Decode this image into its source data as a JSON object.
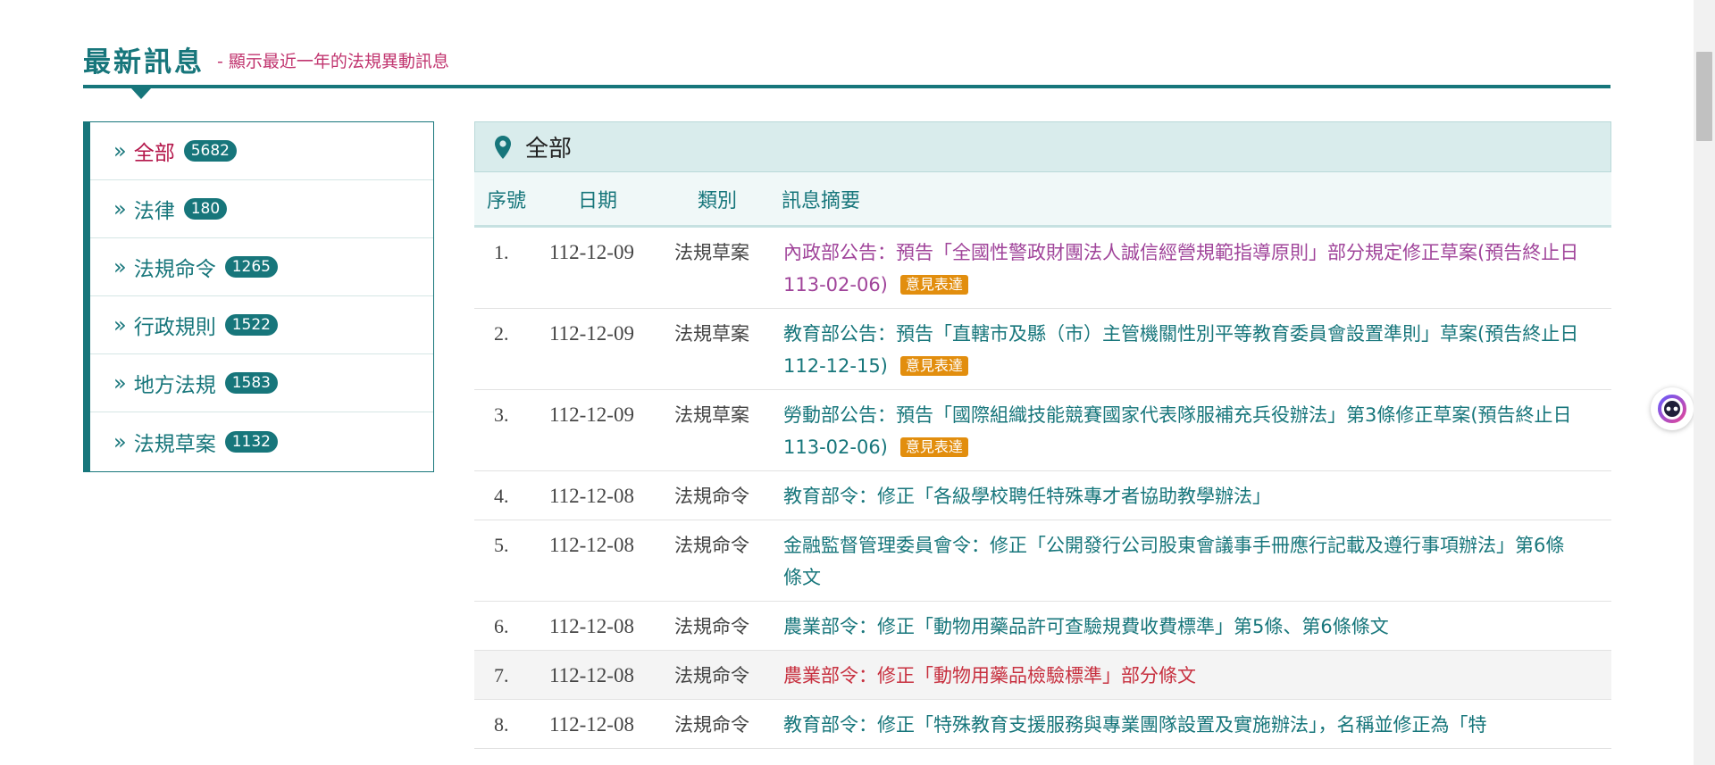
{
  "header": {
    "title": "最新訊息",
    "subtitle": "- 顯示最近一年的法規異動訊息"
  },
  "sidebar": {
    "items": [
      {
        "label": "全部",
        "count": "5682",
        "active": true
      },
      {
        "label": "法律",
        "count": "180"
      },
      {
        "label": "法規命令",
        "count": "1265"
      },
      {
        "label": "行政規則",
        "count": "1522"
      },
      {
        "label": "地方法規",
        "count": "1583"
      },
      {
        "label": "法規草案",
        "count": "1132"
      }
    ]
  },
  "panel": {
    "title": "全部",
    "pin_icon": "map-pin-icon"
  },
  "table": {
    "headers": {
      "no": "序號",
      "date": "日期",
      "category": "類別",
      "summary": "訊息摘要"
    },
    "rows": [
      {
        "no": "1.",
        "date": "112-12-09",
        "category": "法規草案",
        "summary": "內政部公告：預告「全國性警政財團法人誠信經營規範指導原則」部分規定修正草案(預告終止日 113-02-06)",
        "badge": "意見表達"
      },
      {
        "no": "2.",
        "date": "112-12-09",
        "category": "法規草案",
        "summary": "教育部公告：預告「直轄市及縣（市）主管機關性別平等教育委員會設置準則」草案(預告終止日 112-12-15)",
        "badge": "意見表達"
      },
      {
        "no": "3.",
        "date": "112-12-09",
        "category": "法規草案",
        "summary": "勞動部公告：預告「國際組織技能競賽國家代表隊服補充兵役辦法」第3條修正草案(預告終止日 113-02-06)",
        "badge": "意見表達"
      },
      {
        "no": "4.",
        "date": "112-12-08",
        "category": "法規命令",
        "summary": "教育部令：修正「各級學校聘任特殊專才者協助教學辦法」"
      },
      {
        "no": "5.",
        "date": "112-12-08",
        "category": "法規命令",
        "summary": "金融監督管理委員會令：修正「公開發行公司股東會議事手冊應行記載及遵行事項辦法」第6條條文"
      },
      {
        "no": "6.",
        "date": "112-12-08",
        "category": "法規命令",
        "summary": "農業部令：修正「動物用藥品許可查驗規費收費標準」第5條、第6條條文"
      },
      {
        "no": "7.",
        "date": "112-12-08",
        "category": "法規命令",
        "summary": "農業部令：修正「動物用藥品檢驗標準」部分條文"
      },
      {
        "no": "8.",
        "date": "112-12-08",
        "category": "法規命令",
        "summary": "教育部令：修正「特殊教育支援服務與專業團隊設置及實施辦法」，名稱並修正為「特"
      }
    ]
  },
  "colors": {
    "accent": "#17767b",
    "active": "#b4164a",
    "badge": "#e28e0e",
    "visited": "#a0449a",
    "hot": "#c7303f"
  },
  "widget_icon": "assistant-face-icon"
}
